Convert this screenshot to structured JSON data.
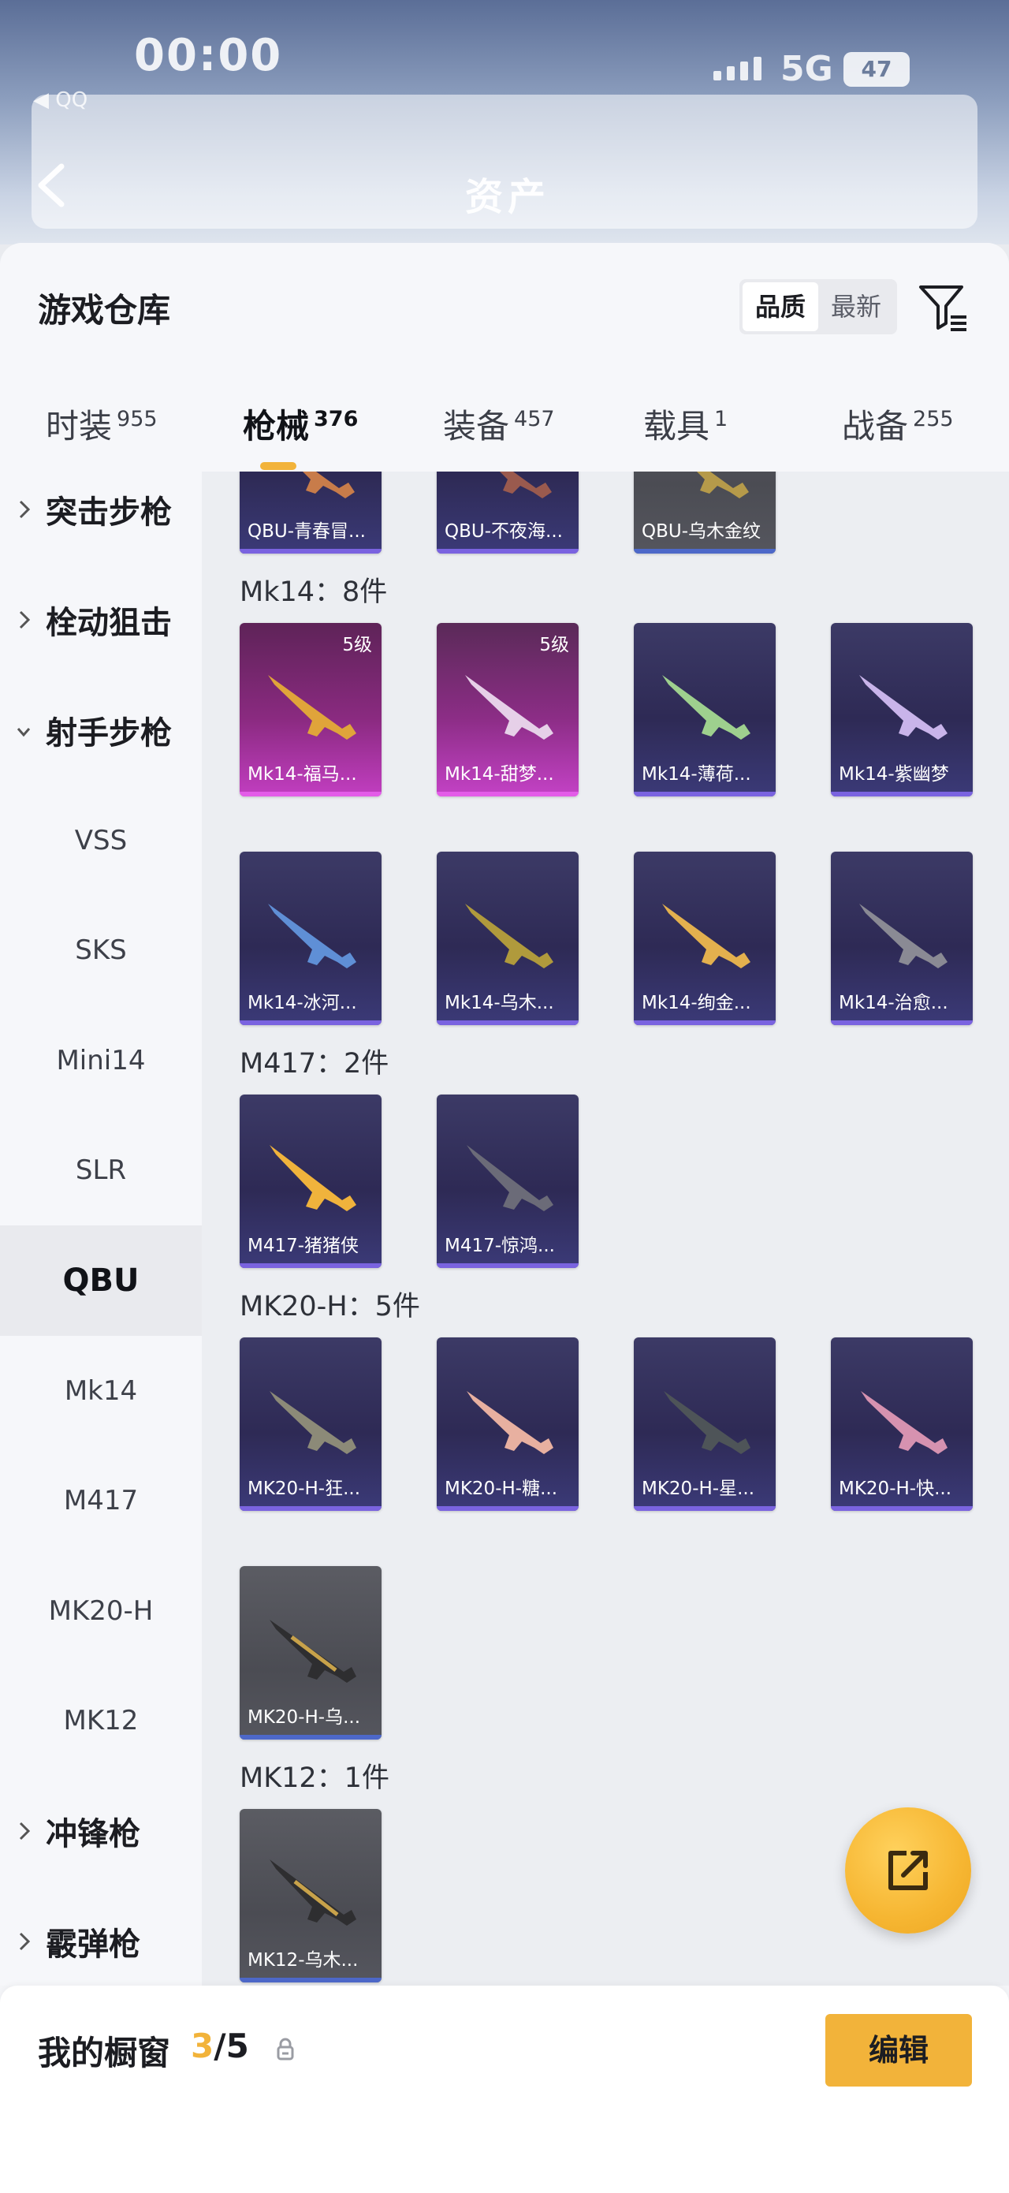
{
  "status": {
    "time": "00:00",
    "network": "5G",
    "battery": "47",
    "audio": "◀ QQ"
  },
  "nav": {
    "title": "资产"
  },
  "sheet": {
    "title": "游戏仓库"
  },
  "sort": {
    "options": [
      "品质",
      "最新"
    ],
    "active": "品质"
  },
  "tabs": [
    {
      "label": "时装",
      "count": "955"
    },
    {
      "label": "枪械",
      "count": "376"
    },
    {
      "label": "装备",
      "count": "457"
    },
    {
      "label": "载具",
      "count": "1"
    },
    {
      "label": "战备",
      "count": "255"
    }
  ],
  "sidebar": {
    "groups": [
      {
        "label": "突击步枪"
      },
      {
        "label": "栓动狙击"
      },
      {
        "label": "射手步枪"
      },
      {
        "label": "冲锋枪"
      },
      {
        "label": "霰弹枪"
      }
    ],
    "items": [
      "VSS",
      "SKS",
      "Mini14",
      "SLR",
      "QBU",
      "Mk14",
      "M417",
      "MK20-H",
      "MK12"
    ],
    "active": "QBU"
  },
  "sections": {
    "qbu": {
      "items": [
        "QBU-青春冒...",
        "QBU-不夜海...",
        "QBU-乌木金纹"
      ]
    },
    "mk14": {
      "label": "Mk14：8件",
      "items": [
        "Mk14-福马...",
        "Mk14-甜梦...",
        "Mk14-薄荷...",
        "Mk14-紫幽梦",
        "Mk14-冰河...",
        "Mk14-乌木...",
        "Mk14-绚金...",
        "Mk14-治愈..."
      ],
      "levels": [
        "5级",
        "5级"
      ]
    },
    "m417": {
      "label": "M417：2件",
      "items": [
        "M417-猪猪侠",
        "M417-惊鸿..."
      ]
    },
    "mk20h": {
      "label": "MK20-H：5件",
      "items": [
        "MK20-H-狂...",
        "MK20-H-糖...",
        "MK20-H-星...",
        "MK20-H-快...",
        "MK20-H-乌..."
      ]
    },
    "mk12": {
      "label": "MK12：1件",
      "items": [
        "MK12-乌木..."
      ]
    }
  },
  "showcase": {
    "label": "我的橱窗",
    "current": "3",
    "total": "/5",
    "edit": "编辑"
  },
  "colors": {
    "accent": "#f2b33a",
    "legendary": "#e35ce8",
    "epic": "#7a63e0"
  }
}
